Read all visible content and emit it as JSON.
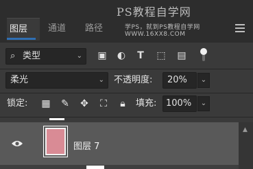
{
  "tabs": [
    {
      "label": "图层"
    },
    {
      "label": "通道"
    },
    {
      "label": "路径"
    }
  ],
  "watermark": {
    "title": "PS教程自学网",
    "subtitle": "学PS，就到PS教程自学网",
    "url": "WWW.16XX8.COM"
  },
  "filter": {
    "search_icon": "search-icon",
    "kind_label": "类型",
    "icons": [
      "pixel-filter-icon",
      "adjustment-filter-icon",
      "type-filter-icon",
      "shape-filter-icon",
      "smart-object-filter-icon",
      "filter-toggle-icon"
    ]
  },
  "blend": {
    "mode": "柔光",
    "opacity_label": "不透明度:",
    "opacity_value": "20%"
  },
  "lock": {
    "label": "锁定:",
    "fill_label": "填充:",
    "fill_value": "100%"
  },
  "layers": [
    {
      "name": "图层 7",
      "visible": true,
      "thumb_color": "#d98b95"
    }
  ],
  "colors": {
    "panel_bg": "#3a3a3a",
    "selected_row": "#595959",
    "accent": "#2f6fb3"
  }
}
